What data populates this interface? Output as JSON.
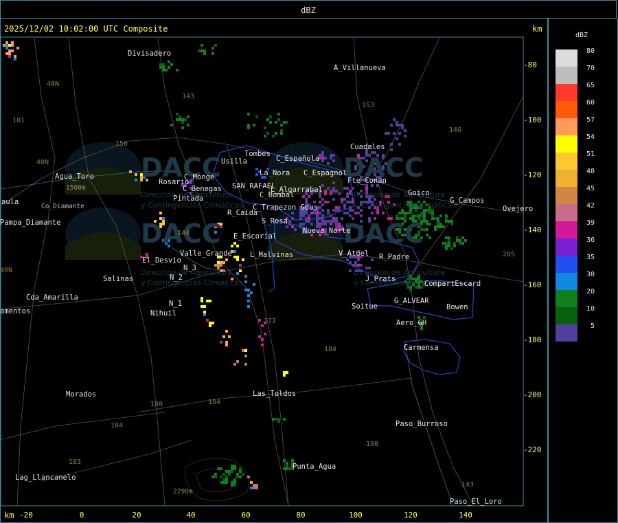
{
  "header": {
    "unit_title": "dBZ"
  },
  "map": {
    "timestamp": "2025/12/02 10:02:00 UTC Composite",
    "km_label_top": "km",
    "km_label_bottom": "km",
    "y_ticks": [
      "-80",
      "-100",
      "-120",
      "-140",
      "-160",
      "-180",
      "-200",
      "-220"
    ],
    "x_ticks": [
      "-20",
      "0",
      "20",
      "40",
      "60",
      "80",
      "100",
      "120",
      "140"
    ],
    "places": [
      {
        "name": "Divisadero"
      },
      {
        "name": "A_Villanueva"
      },
      {
        "name": "Cuadales"
      },
      {
        "name": "Tombes"
      },
      {
        "name": "Usilla"
      },
      {
        "name": "C_Española"
      },
      {
        "name": "La_Nora"
      },
      {
        "name": "C_Espagnol"
      },
      {
        "name": "Agua_Toro"
      },
      {
        "name": "Rosario"
      },
      {
        "name": "C_Monge"
      },
      {
        "name": "C_Benegas"
      },
      {
        "name": "SAN_RAFAEL"
      },
      {
        "name": "L_Algarrabal"
      },
      {
        "name": "Fte_Conan"
      },
      {
        "name": "Goico"
      },
      {
        "name": "G_Campos"
      },
      {
        "name": "Ovejero"
      },
      {
        "name": "aula"
      },
      {
        "name": "Pintada"
      },
      {
        "name": "C_Bombal"
      },
      {
        "name": "C_Trapezon Gous"
      },
      {
        "name": "R_Caida"
      },
      {
        "name": "S_Rosa"
      },
      {
        "name": "Pampa_Diamante"
      },
      {
        "name": "Nueva_Norte"
      },
      {
        "name": "E_Escorial"
      },
      {
        "name": "Valle_Grande"
      },
      {
        "name": "El_Desvio"
      },
      {
        "name": "L_Malvinas"
      },
      {
        "name": "V_Atuel"
      },
      {
        "name": "R_Padre"
      },
      {
        "name": "Salinas"
      },
      {
        "name": "N_2"
      },
      {
        "name": "N_3"
      },
      {
        "name": "J_Prats"
      },
      {
        "name": "CompartEscard"
      },
      {
        "name": "Cda_Amarilla"
      },
      {
        "name": "N_1"
      },
      {
        "name": "Nihuil"
      },
      {
        "name": "G_ALVEAR"
      },
      {
        "name": "Soitue"
      },
      {
        "name": "Bowen"
      },
      {
        "name": "amentos"
      },
      {
        "name": "Aero_GH"
      },
      {
        "name": "Carmensa"
      },
      {
        "name": "Morados"
      },
      {
        "name": "Las_Toldos"
      },
      {
        "name": "Paso_Burroso"
      },
      {
        "name": "Lag_Llancanelo"
      },
      {
        "name": "Punta_Agua"
      },
      {
        "name": "Paso_El_Loro"
      },
      {
        "name": "Co_Diamante"
      }
    ],
    "routes": [
      "40N",
      "101",
      "143",
      "153",
      "146",
      "150",
      "40N",
      "144",
      "173",
      "184",
      "180",
      "184",
      "184",
      "183",
      "190",
      "143",
      "205",
      "40N"
    ],
    "elevations": [
      "1500m",
      "2290m"
    ],
    "watermark": {
      "logo_text": "DACC",
      "line1": "Dirección de Agricultura",
      "line2": "y Contingencias Climáticas"
    }
  },
  "legend": {
    "title": "dBZ",
    "levels": [
      {
        "label": "80",
        "color": "#dcdcdc"
      },
      {
        "label": "70",
        "color": "#bdbdbd"
      },
      {
        "label": "65",
        "color": "#ff3a2a"
      },
      {
        "label": "60",
        "color": "#ff5a0a"
      },
      {
        "label": "57",
        "color": "#ff9a5a"
      },
      {
        "label": "54",
        "color": "#ffff00"
      },
      {
        "label": "51",
        "color": "#ffc830"
      },
      {
        "label": "48",
        "color": "#f0b030"
      },
      {
        "label": "45",
        "color": "#d08840"
      },
      {
        "label": "42",
        "color": "#c86c8c"
      },
      {
        "label": "39",
        "color": "#d01898"
      },
      {
        "label": "36",
        "color": "#7a20d0"
      },
      {
        "label": "35",
        "color": "#2050f0"
      },
      {
        "label": "30",
        "color": "#1088e0"
      },
      {
        "label": "20",
        "color": "#10801c"
      },
      {
        "label": "10",
        "color": "#086010"
      },
      {
        "label": "5",
        "color": "#50409c"
      }
    ]
  }
}
